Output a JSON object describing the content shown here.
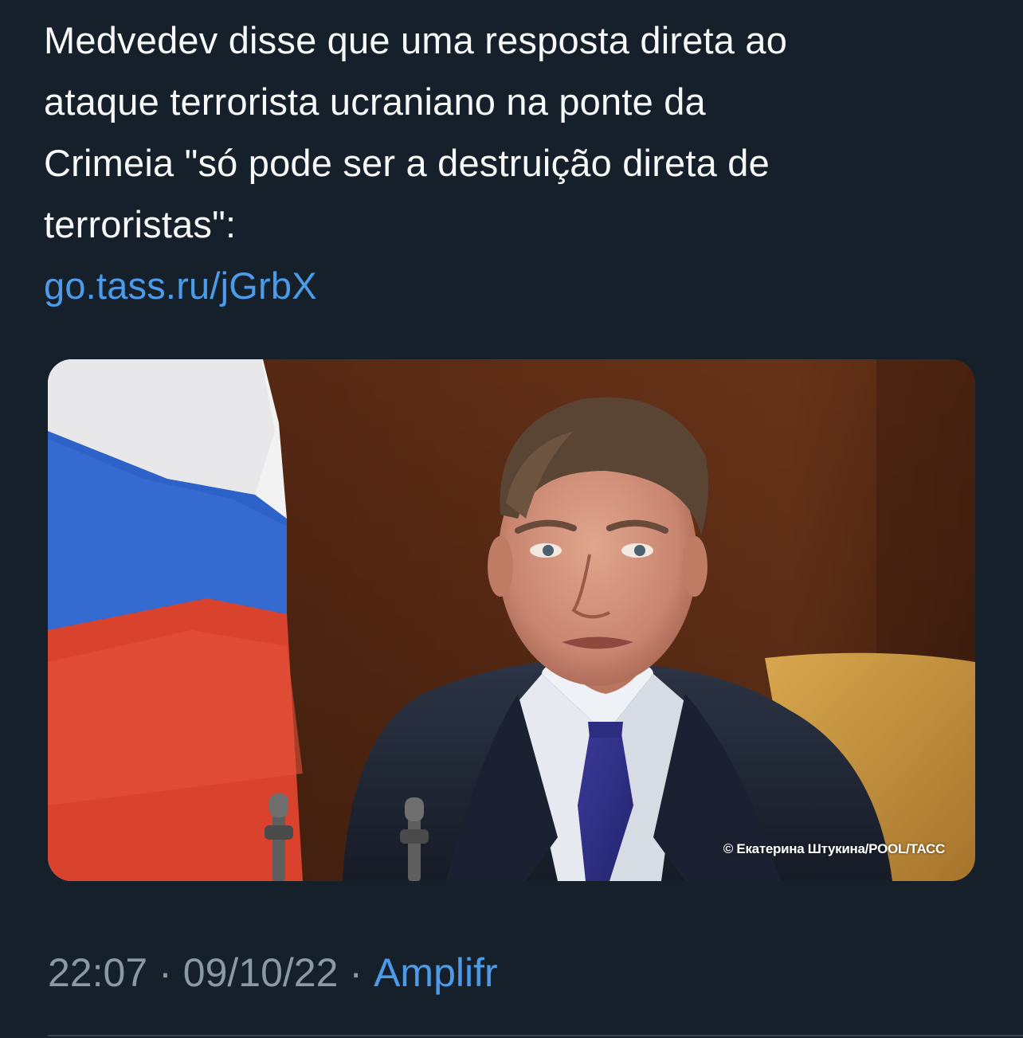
{
  "tweet": {
    "text_lines": [
      "Medvedev disse que uma resposta direta ao",
      "ataque terrorista ucraniano na ponte da",
      "Crimeia \"só pode ser a destruição direta de",
      "terroristas\":"
    ],
    "link_text": "go.tass.ru/jGrbX",
    "media": {
      "photo_credit": "© Екатерина Штукина/POOL/ТАСС"
    },
    "time": "22:07",
    "date": "09/10/22",
    "separator": "·",
    "source": "Amplifr"
  },
  "colors": {
    "background": "#15202b",
    "text": "#f7f9f9",
    "link": "#4c9be8",
    "muted": "#8b98a5"
  }
}
